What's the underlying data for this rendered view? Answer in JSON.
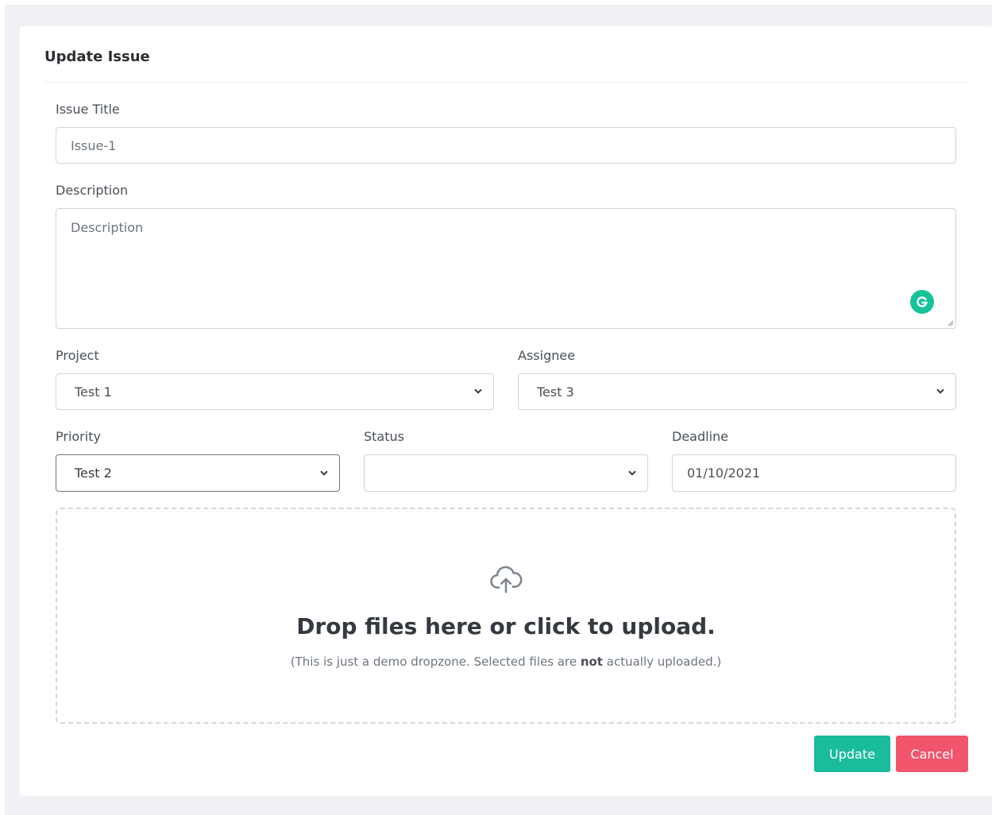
{
  "form": {
    "heading": "Update Issue",
    "issue_title": {
      "label": "Issue Title",
      "placeholder": "Issue-1"
    },
    "description": {
      "label": "Description",
      "placeholder": "Description"
    },
    "project": {
      "label": "Project",
      "value": "Test 1"
    },
    "assignee": {
      "label": "Assignee",
      "value": "Test 3"
    },
    "priority": {
      "label": "Priority",
      "value": "Test 2"
    },
    "status": {
      "label": "Status",
      "value": ""
    },
    "deadline": {
      "label": "Deadline",
      "value": "01/10/2021"
    }
  },
  "dropzone": {
    "icon": "cloud-upload-icon",
    "title": "Drop files here or click to upload.",
    "note_before": "(This is just a demo dropzone. Selected files are ",
    "note_bold": "not",
    "note_after": " actually uploaded.)"
  },
  "actions": {
    "update_label": "Update",
    "cancel_label": "Cancel"
  },
  "colors": {
    "update": "#1abc9c",
    "cancel": "#f1556c",
    "grammarly": "#15c39a"
  }
}
